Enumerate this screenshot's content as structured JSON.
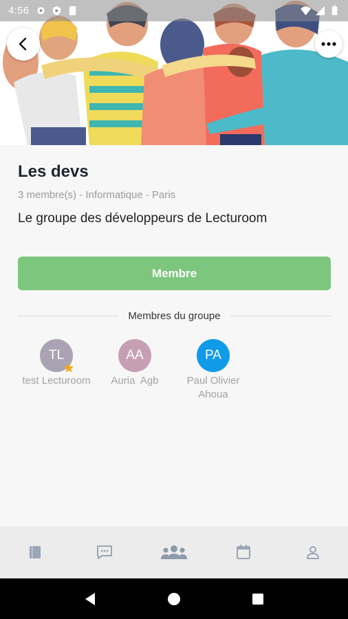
{
  "status_bar": {
    "time": "4:56",
    "icons_left": [
      "gear-icon",
      "shield-icon",
      "sd-card-icon"
    ],
    "icons_right": [
      "wifi-icon",
      "signal-icon",
      "battery-icon"
    ]
  },
  "header": {
    "back_icon": "chevron-left-icon",
    "more_icon": "more-horizontal-icon"
  },
  "group": {
    "name": "Les devs",
    "meta": "3 membre(s) - Informatique - Paris",
    "description": "Le groupe des développeurs de Lecturoom"
  },
  "actions": {
    "member_button": "Membre"
  },
  "members_section": {
    "title": "Membres du groupe",
    "members": [
      {
        "initials": "TL",
        "name": "test Lecturoom",
        "color": "#a9a3b3",
        "admin": true
      },
      {
        "initials": "AA",
        "name": "Auria  Agb",
        "color": "#c79fb5",
        "admin": false
      },
      {
        "initials": "PA",
        "name": "Paul Olivier\nAhoua",
        "color": "#0f9be8",
        "admin": false
      }
    ],
    "admin_badge_color": "#f5a623"
  },
  "tab_bar": {
    "tabs": [
      "book-icon",
      "chat-icon",
      "groups-icon",
      "calendar-icon",
      "profile-icon"
    ],
    "active": "groups-icon",
    "active_color": "#8e9aab",
    "inactive_color": "#9aa6b6"
  },
  "colors": {
    "primary_green": "#7dc67e",
    "title": "#1f2430",
    "muted": "#9a9a9a"
  }
}
